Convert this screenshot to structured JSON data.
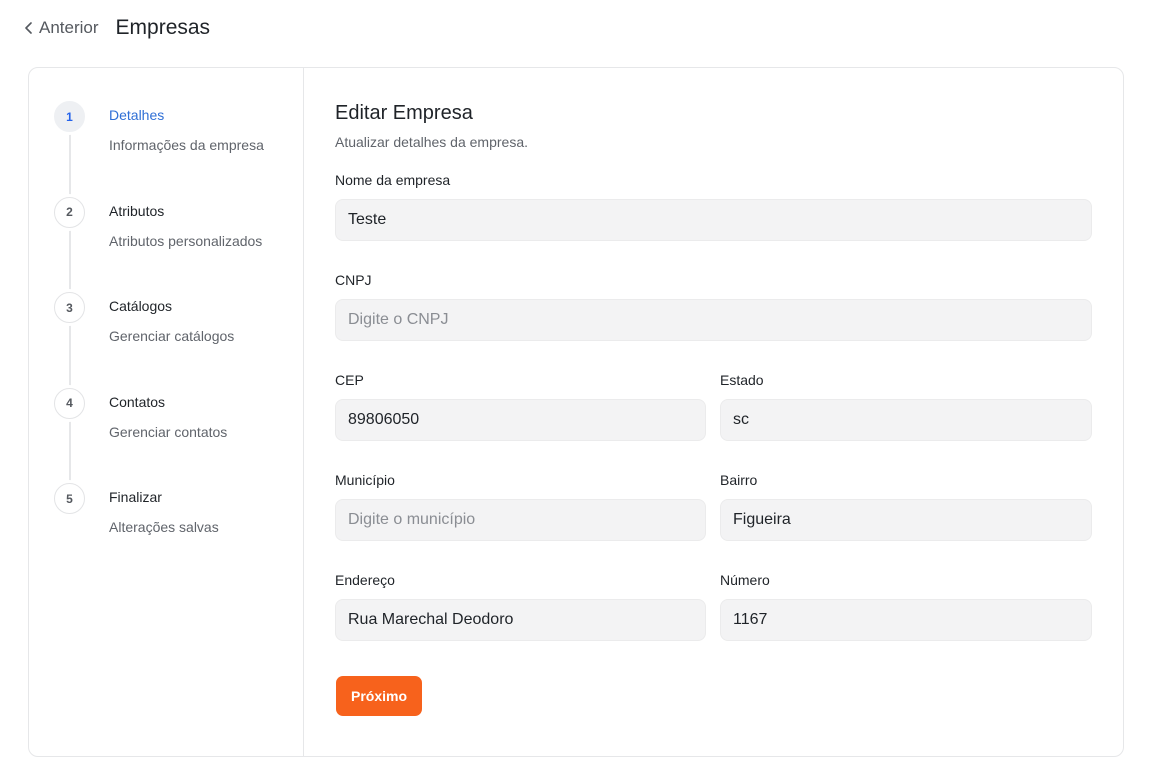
{
  "header": {
    "back_label": "Anterior",
    "title": "Empresas"
  },
  "steps": [
    {
      "number": "1",
      "title": "Detalhes",
      "subtitle": "Informações da empresa"
    },
    {
      "number": "2",
      "title": "Atributos",
      "subtitle": "Atributos personalizados"
    },
    {
      "number": "3",
      "title": "Catálogos",
      "subtitle": "Gerenciar catálogos"
    },
    {
      "number": "4",
      "title": "Contatos",
      "subtitle": "Gerenciar contatos"
    },
    {
      "number": "5",
      "title": "Finalizar",
      "subtitle": "Alterações salvas"
    }
  ],
  "active_step": "1",
  "colors": {
    "accent": "#f7621c",
    "active_step_text": "#2f6fd6"
  },
  "form": {
    "title": "Editar Empresa",
    "subtitle": "Atualizar detalhes da empresa.",
    "fields": {
      "company_name": {
        "label": "Nome da empresa",
        "value": "Teste",
        "placeholder": ""
      },
      "cnpj": {
        "label": "CNPJ",
        "value": "",
        "placeholder": "Digite o CNPJ"
      },
      "cep": {
        "label": "CEP",
        "value": "89806050",
        "placeholder": ""
      },
      "estado": {
        "label": "Estado",
        "value": "sc",
        "placeholder": ""
      },
      "municipio": {
        "label": "Município",
        "value": "",
        "placeholder": "Digite o município"
      },
      "bairro": {
        "label": "Bairro",
        "value": "Figueira",
        "placeholder": ""
      },
      "endereco": {
        "label": "Endereço",
        "value": "Rua Marechal Deodoro",
        "placeholder": ""
      },
      "numero": {
        "label": "Número",
        "value": "1167",
        "placeholder": ""
      }
    },
    "next_label": "Próximo"
  }
}
